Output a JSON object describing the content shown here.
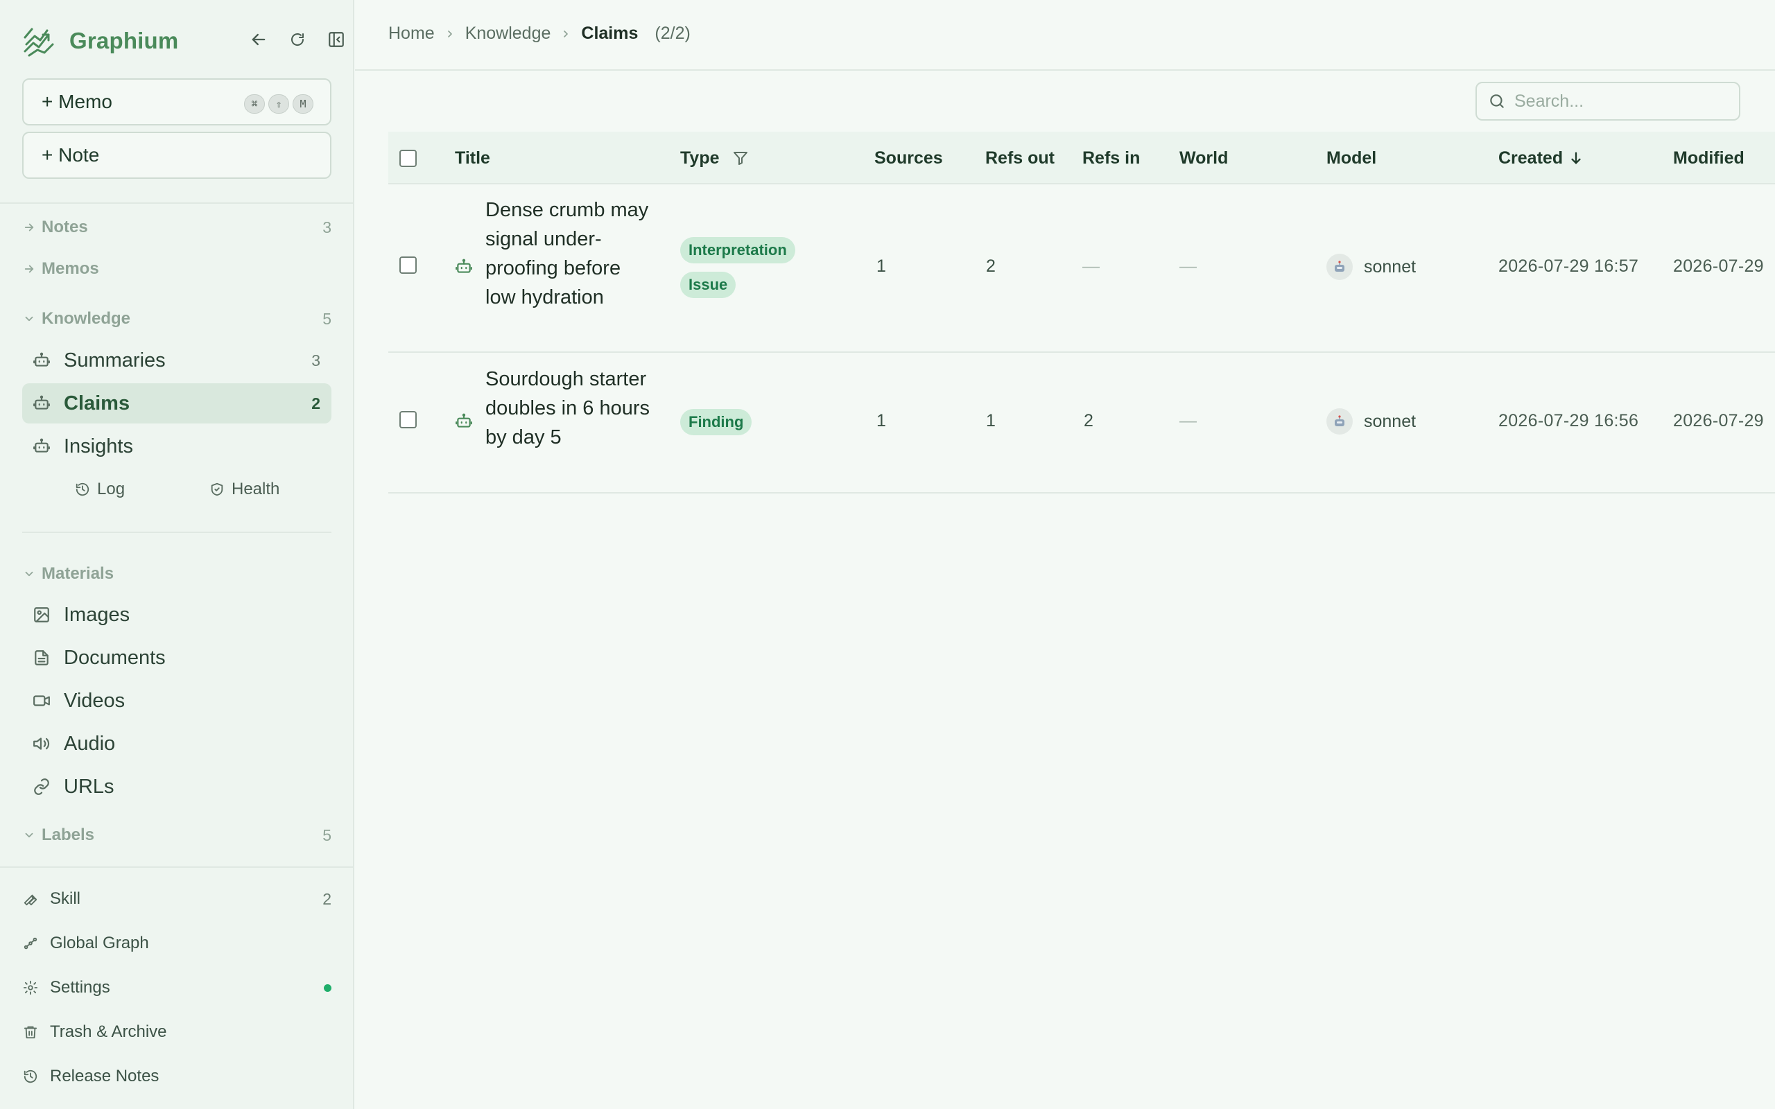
{
  "app": {
    "name": "Graphium"
  },
  "sidebar": {
    "new_memo": {
      "label": "+ Memo",
      "shortcut": [
        "⌘",
        "⇧",
        "M"
      ]
    },
    "new_note": {
      "label": "+ Note"
    },
    "notes": {
      "label": "Notes",
      "count": "3"
    },
    "memos": {
      "label": "Memos"
    },
    "knowledge": {
      "label": "Knowledge",
      "count": "5",
      "items": [
        {
          "label": "Summaries",
          "count": "3",
          "icon": "robot-icon"
        },
        {
          "label": "Claims",
          "count": "2",
          "icon": "robot-icon",
          "active": true
        },
        {
          "label": "Insights",
          "icon": "robot-icon"
        }
      ],
      "log": "Log",
      "health": "Health"
    },
    "materials": {
      "label": "Materials",
      "items": [
        {
          "label": "Images",
          "icon": "image-icon"
        },
        {
          "label": "Documents",
          "icon": "document-icon"
        },
        {
          "label": "Videos",
          "icon": "video-icon"
        },
        {
          "label": "Audio",
          "icon": "speaker-icon"
        },
        {
          "label": "URLs",
          "icon": "link-icon"
        }
      ]
    },
    "labels": {
      "label": "Labels",
      "count": "5"
    },
    "footer": {
      "skill": {
        "label": "Skill",
        "count": "2"
      },
      "global_graph": {
        "label": "Global Graph"
      },
      "settings": {
        "label": "Settings",
        "status_color": "#1fae6a"
      },
      "trash": {
        "label": "Trash & Archive"
      },
      "release_notes": {
        "label": "Release Notes"
      }
    }
  },
  "breadcrumb": {
    "home": "Home",
    "knowledge": "Knowledge",
    "current": "Claims",
    "count": "(2/2)"
  },
  "search": {
    "placeholder": "Search..."
  },
  "table": {
    "columns": {
      "title": "Title",
      "type": "Type",
      "sources": "Sources",
      "refs_out": "Refs out",
      "refs_in": "Refs in",
      "world": "World",
      "model": "Model",
      "created": "Created",
      "modified": "Modified"
    },
    "sort": {
      "column": "created",
      "direction": "desc"
    },
    "rows": [
      {
        "title": "Dense crumb may signal under-proofing before low hydration",
        "types": [
          "Interpretation",
          "Issue"
        ],
        "sources": "1",
        "refs_out": "2",
        "refs_in": "—",
        "world": "—",
        "model": "sonnet",
        "created": "2026-07-29 16:57",
        "modified": "2026-07-29"
      },
      {
        "title": "Sourdough starter doubles in 6 hours by day 5",
        "types": [
          "Finding"
        ],
        "sources": "1",
        "refs_out": "1",
        "refs_in": "2",
        "world": "—",
        "model": "sonnet",
        "created": "2026-07-29 16:56",
        "modified": "2026-07-29"
      }
    ]
  },
  "colors": {
    "accent": "#4a8a5a",
    "tag_bg": "#cdebd8",
    "tag_text": "#1d7a4a",
    "active_bg": "#d9e8dd"
  }
}
